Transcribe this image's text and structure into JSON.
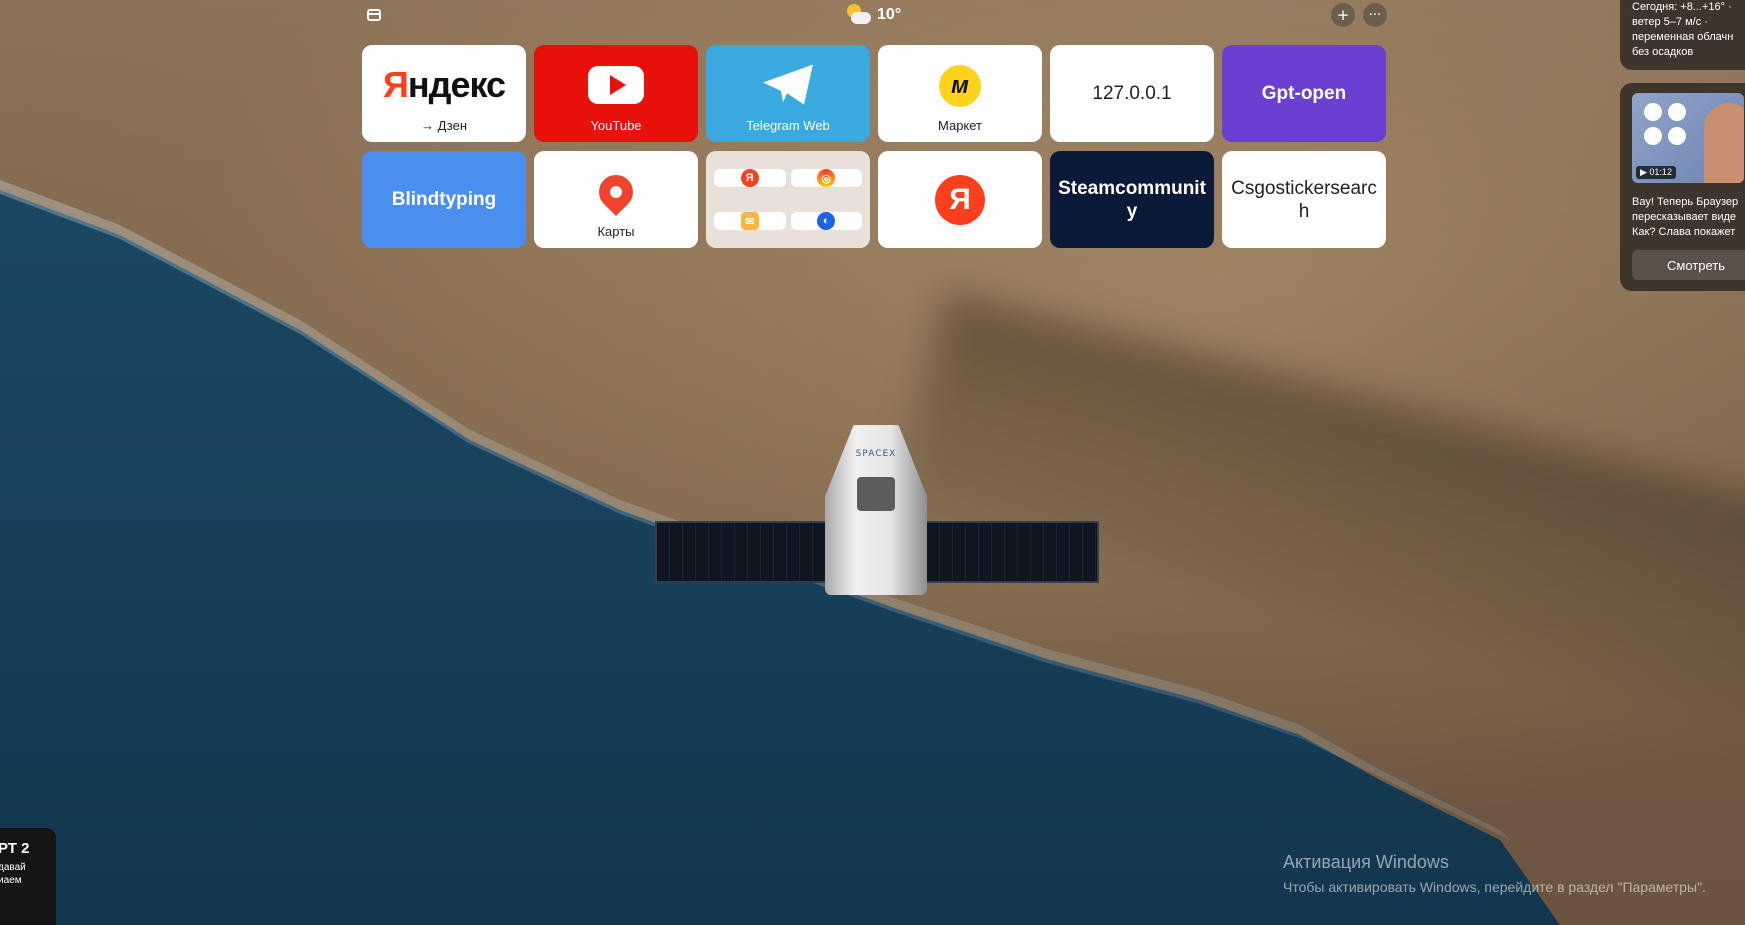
{
  "topbar": {
    "weather_temp": "10°"
  },
  "tiles": [
    {
      "label": "→ Дзен",
      "logo_text": "Яндекс",
      "bg": "#ffffff"
    },
    {
      "label": "YouTube",
      "bg": "#e8110b"
    },
    {
      "label": "Telegram Web",
      "bg": "#3aa9e0"
    },
    {
      "label": "Маркет",
      "bg": "#ffffff"
    },
    {
      "title": "127.0.0.1",
      "bg": "#ffffff"
    },
    {
      "title": "Gpt-open",
      "bg": "#6a3fd1"
    },
    {
      "title": "Blindtyping",
      "bg": "#4b8fee"
    },
    {
      "label": "Карты",
      "bg": "#ffffff"
    },
    {
      "folder": [
        "yandex-icon",
        "music-icon",
        "mail-icon",
        "disk-icon"
      ]
    },
    {
      "logo_text": "Я",
      "bg": "#ffffff"
    },
    {
      "title": "Steamcommunity",
      "bg": "#0c1a3a"
    },
    {
      "title": "Csgostickersearch",
      "bg": "#ffffff"
    }
  ],
  "side_weather": {
    "line1": "Сегодня: +8...+16° ·",
    "line2": "ветер 5–7 м/с ·",
    "line3": "переменная облачн",
    "line4": "без осадков"
  },
  "side_video": {
    "duration": "01:12",
    "line1": "Вау! Теперь Браузер",
    "line2": "пересказывает виде",
    "line3": "Как? Слава покажет",
    "watch_label": "Смотреть"
  },
  "bottom_card": {
    "title": "РТ 2",
    "line1": "давай",
    "line2": "иаем"
  },
  "activation": {
    "title": "Активация Windows",
    "subtitle": "Чтобы активировать Windows, перейдите в раздел \"Параметры\"."
  },
  "colors": {
    "accent_red": "#fc3f1d",
    "youtube": "#e8110b",
    "telegram": "#3aa9e0",
    "gpt": "#6a3fd1",
    "blind": "#4b8fee",
    "steam": "#0c1a3a"
  }
}
